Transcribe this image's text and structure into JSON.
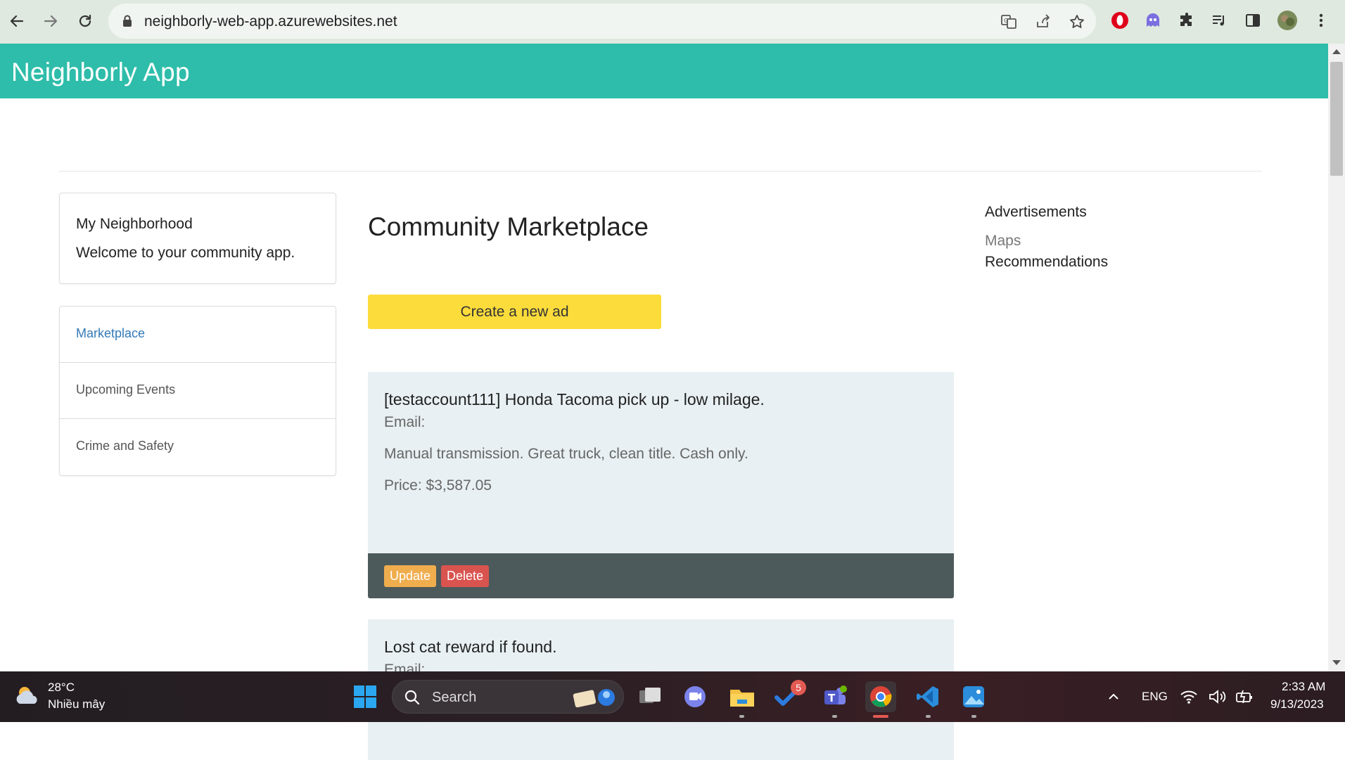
{
  "browser": {
    "url": "neighborly-web-app.azurewebsites.net"
  },
  "app": {
    "title": "Neighborly App"
  },
  "sidebar": {
    "neighborhood_title": "My Neighborhood",
    "neighborhood_subtitle": "Welcome to your community app.",
    "menu": [
      {
        "label": "Marketplace",
        "active": true
      },
      {
        "label": "Upcoming Events",
        "active": false
      },
      {
        "label": "Crime and Safety",
        "active": false
      }
    ]
  },
  "main": {
    "title": "Community Marketplace",
    "create_button": "Create a new ad",
    "ads": [
      {
        "title": "[testaccount111] Honda Tacoma pick up - low milage.",
        "email": "Email:",
        "description": "Manual transmission. Great truck, clean title. Cash only.",
        "price": "Price: $3,587.05",
        "update_label": "Update",
        "delete_label": "Delete"
      },
      {
        "title": "Lost cat reward if found.",
        "email": "Email:"
      }
    ]
  },
  "right": {
    "title": "Advertisements",
    "link1": "Maps",
    "link2": "Recommendations"
  },
  "taskbar": {
    "temperature": "28°C",
    "weather": "Nhiều mây",
    "search_label": "Search",
    "todo_badge": "5",
    "language": "ENG",
    "time": "2:33 AM",
    "date": "9/13/2023"
  },
  "colors": {
    "header": "#2ebdaa",
    "create_button": "#fcdc3b",
    "update_button": "#f0ad4e",
    "delete_button": "#d9534f",
    "ad_footer": "#4d5a5b",
    "ad_background": "#e8f0f3"
  }
}
